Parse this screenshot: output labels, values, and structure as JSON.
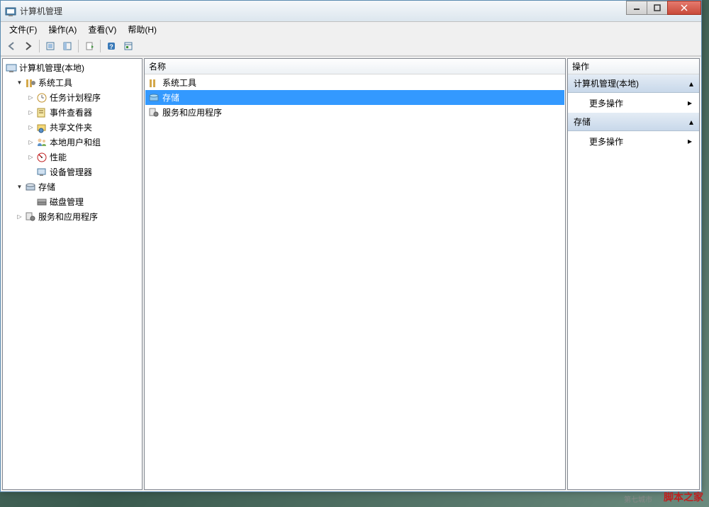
{
  "window": {
    "title": "计算机管理"
  },
  "menubar": {
    "items": [
      "文件(F)",
      "操作(A)",
      "查看(V)",
      "帮助(H)"
    ]
  },
  "tree": {
    "root": "计算机管理(本地)",
    "nodes": [
      {
        "label": "系统工具",
        "depth": 1,
        "expand": "▼",
        "icon": "tools"
      },
      {
        "label": "任务计划程序",
        "depth": 2,
        "expand": "▷",
        "icon": "clock"
      },
      {
        "label": "事件查看器",
        "depth": 2,
        "expand": "▷",
        "icon": "event"
      },
      {
        "label": "共享文件夹",
        "depth": 2,
        "expand": "▷",
        "icon": "share"
      },
      {
        "label": "本地用户和组",
        "depth": 2,
        "expand": "▷",
        "icon": "users"
      },
      {
        "label": "性能",
        "depth": 2,
        "expand": "▷",
        "icon": "perf"
      },
      {
        "label": "设备管理器",
        "depth": 2,
        "expand": "",
        "icon": "device"
      },
      {
        "label": "存储",
        "depth": 1,
        "expand": "▼",
        "icon": "storage"
      },
      {
        "label": "磁盘管理",
        "depth": 2,
        "expand": "",
        "icon": "disk"
      },
      {
        "label": "服务和应用程序",
        "depth": 1,
        "expand": "▷",
        "icon": "services"
      }
    ]
  },
  "list": {
    "header": "名称",
    "items": [
      {
        "label": "系统工具",
        "icon": "tools",
        "selected": false
      },
      {
        "label": "存储",
        "icon": "storage",
        "selected": true
      },
      {
        "label": "服务和应用程序",
        "icon": "services",
        "selected": false
      }
    ]
  },
  "actions": {
    "header": "操作",
    "sections": [
      {
        "title": "计算机管理(本地)",
        "items": [
          "更多操作"
        ]
      },
      {
        "title": "存储",
        "items": [
          "更多操作"
        ]
      }
    ]
  },
  "watermark": "脚本之家",
  "watermark2": "第七城市"
}
